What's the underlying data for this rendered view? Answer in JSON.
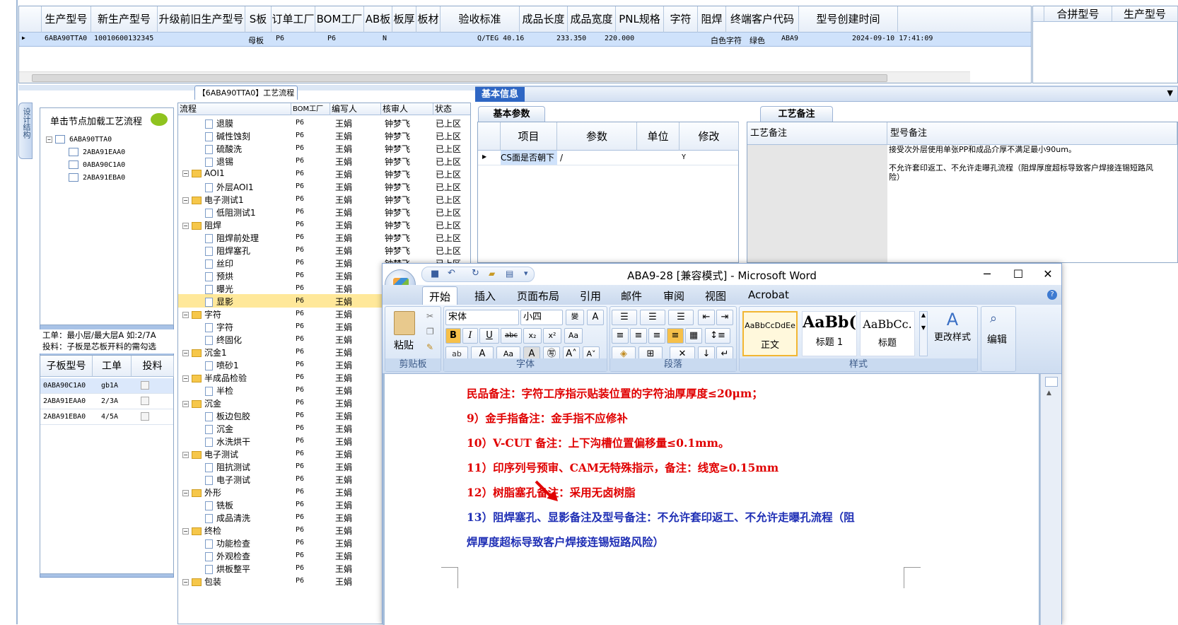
{
  "top_grid": {
    "headers": [
      "生产型号",
      "新生产型号",
      "升级前旧生产型号",
      "S板",
      "订单工厂",
      "BOM工厂",
      "AB板",
      "板厚",
      "板材",
      "验收标准",
      "成品长度",
      "成品宽度",
      "PNL规格",
      "字符",
      "阻焊",
      "终端客户代码",
      "型号创建时间"
    ],
    "row": {
      "prod_no": "6ABA90TTA0",
      "new_no": "10010600132345",
      "sboard": "母板",
      "order_factory": "P6",
      "bom_factory": "P6",
      "ab": "N",
      "standard": "Q/TEG 40.16",
      "length": "233.350",
      "width": "220.000",
      "char": "白色字符",
      "mask": "绿色",
      "customer": "ABA9",
      "created": "2024-09-10 17:41:09"
    }
  },
  "merge_grid": {
    "headers": [
      "合拼型号",
      "生产型号"
    ]
  },
  "left_panel": {
    "vtab": "设计结构",
    "tree_title": "单击节点加载工艺流程",
    "tree_root": "6ABA90TTA0",
    "tree_children": [
      "2ABA91EAA0",
      "0ABA90C1A0",
      "2ABA91EBA0"
    ],
    "info_line1": "工单：最小层/最大层A 如:2/7A",
    "info_line2": "投料：子板是芯板开料的需勾选",
    "sub_headers": [
      "子板型号",
      "工单",
      "投料"
    ],
    "sub_rows": [
      {
        "model": "0ABA90C1A0",
        "order": "gb1A"
      },
      {
        "model": "2ABA91EAA0",
        "order": "2/3A"
      },
      {
        "model": "2ABA91EBA0",
        "order": "4/5A"
      }
    ]
  },
  "process": {
    "title": "【6ABA90TTA0】工艺流程",
    "headers": [
      "流程",
      "BOM工厂",
      "编写人",
      "核审人",
      "状态"
    ],
    "rows": [
      {
        "name": "退膜",
        "folder": false,
        "bom": "P6",
        "writer": "王娟",
        "reviewer": "钟梦飞",
        "status": "已上区"
      },
      {
        "name": "碱性蚀刻",
        "folder": false,
        "bom": "P6",
        "writer": "王娟",
        "reviewer": "钟梦飞",
        "status": "已上区"
      },
      {
        "name": "硫酸洗",
        "folder": false,
        "bom": "P6",
        "writer": "王娟",
        "reviewer": "钟梦飞",
        "status": "已上区"
      },
      {
        "name": "退锡",
        "folder": false,
        "bom": "P6",
        "writer": "王娟",
        "reviewer": "钟梦飞",
        "status": "已上区"
      },
      {
        "name": "AOI1",
        "folder": true,
        "bom": "P6",
        "writer": "王娟",
        "reviewer": "钟梦飞",
        "status": "已上区"
      },
      {
        "name": "外层AOI1",
        "folder": false,
        "bom": "P6",
        "writer": "王娟",
        "reviewer": "钟梦飞",
        "status": "已上区"
      },
      {
        "name": "电子测试1",
        "folder": true,
        "bom": "P6",
        "writer": "王娟",
        "reviewer": "钟梦飞",
        "status": "已上区"
      },
      {
        "name": "低阻测试1",
        "folder": false,
        "bom": "P6",
        "writer": "王娟",
        "reviewer": "钟梦飞",
        "status": "已上区"
      },
      {
        "name": "阻焊",
        "folder": true,
        "bom": "P6",
        "writer": "王娟",
        "reviewer": "钟梦飞",
        "status": "已上区"
      },
      {
        "name": "阻焊前处理",
        "folder": false,
        "bom": "P6",
        "writer": "王娟",
        "reviewer": "钟梦飞",
        "status": "已上区"
      },
      {
        "name": "阻焊塞孔",
        "folder": false,
        "bom": "P6",
        "writer": "王娟",
        "reviewer": "钟梦飞",
        "status": "已上区"
      },
      {
        "name": "丝印",
        "folder": false,
        "bom": "P6",
        "writer": "王娟",
        "reviewer": "钟梦飞",
        "status": "已上区"
      },
      {
        "name": "预烘",
        "folder": false,
        "bom": "P6",
        "writer": "王娟",
        "reviewer": "",
        "status": ""
      },
      {
        "name": "曝光",
        "folder": false,
        "bom": "P6",
        "writer": "王娟",
        "reviewer": "",
        "status": ""
      },
      {
        "name": "显影",
        "folder": false,
        "bom": "P6",
        "writer": "王娟",
        "reviewer": "",
        "status": ""
      },
      {
        "name": "字符",
        "folder": true,
        "bom": "P6",
        "writer": "王娟",
        "reviewer": "",
        "status": ""
      },
      {
        "name": "字符",
        "folder": false,
        "bom": "P6",
        "writer": "王娟",
        "reviewer": "",
        "status": ""
      },
      {
        "name": "终固化",
        "folder": false,
        "bom": "P6",
        "writer": "王娟",
        "reviewer": "",
        "status": ""
      },
      {
        "name": "沉金1",
        "folder": true,
        "bom": "P6",
        "writer": "王娟",
        "reviewer": "",
        "status": ""
      },
      {
        "name": "喷砂1",
        "folder": false,
        "bom": "P6",
        "writer": "王娟",
        "reviewer": "",
        "status": ""
      },
      {
        "name": "半成品检验",
        "folder": true,
        "bom": "P6",
        "writer": "王娟",
        "reviewer": "",
        "status": ""
      },
      {
        "name": "半检",
        "folder": false,
        "bom": "P6",
        "writer": "王娟",
        "reviewer": "",
        "status": ""
      },
      {
        "name": "沉金",
        "folder": true,
        "bom": "P6",
        "writer": "王娟",
        "reviewer": "",
        "status": ""
      },
      {
        "name": "板边包胶",
        "folder": false,
        "bom": "P6",
        "writer": "王娟",
        "reviewer": "",
        "status": ""
      },
      {
        "name": "沉金",
        "folder": false,
        "bom": "P6",
        "writer": "王娟",
        "reviewer": "",
        "status": ""
      },
      {
        "name": "水洗烘干",
        "folder": false,
        "bom": "P6",
        "writer": "王娟",
        "reviewer": "",
        "status": ""
      },
      {
        "name": "电子测试",
        "folder": true,
        "bom": "P6",
        "writer": "王娟",
        "reviewer": "",
        "status": ""
      },
      {
        "name": "阻抗测试",
        "folder": false,
        "bom": "P6",
        "writer": "王娟",
        "reviewer": "",
        "status": ""
      },
      {
        "name": "电子测试",
        "folder": false,
        "bom": "P6",
        "writer": "王娟",
        "reviewer": "",
        "status": ""
      },
      {
        "name": "外形",
        "folder": true,
        "bom": "P6",
        "writer": "王娟",
        "reviewer": "",
        "status": ""
      },
      {
        "name": "铣板",
        "folder": false,
        "bom": "P6",
        "writer": "王娟",
        "reviewer": "",
        "status": ""
      },
      {
        "name": "成品清洗",
        "folder": false,
        "bom": "P6",
        "writer": "王娟",
        "reviewer": "",
        "status": ""
      },
      {
        "name": "终检",
        "folder": true,
        "bom": "P6",
        "writer": "王娟",
        "reviewer": "",
        "status": ""
      },
      {
        "name": "功能检查",
        "folder": false,
        "bom": "P6",
        "writer": "王娟",
        "reviewer": "",
        "status": ""
      },
      {
        "name": "外观检查",
        "folder": false,
        "bom": "P6",
        "writer": "王娟",
        "reviewer": "",
        "status": ""
      },
      {
        "name": "烘板整平",
        "folder": false,
        "bom": "P6",
        "writer": "王娟",
        "reviewer": "",
        "status": ""
      },
      {
        "name": "包装",
        "folder": true,
        "bom": "P6",
        "writer": "王娟",
        "reviewer": "",
        "status": ""
      }
    ],
    "selected_index": 14
  },
  "basic_info": {
    "tab": "基本信息",
    "param_tab": "基本参数",
    "param_headers": [
      "项目",
      "参数",
      "单位",
      "修改"
    ],
    "param_row": {
      "item": "CS面是否朝下",
      "value": "/",
      "unit": "",
      "edit": "Y"
    },
    "craft_tab": "工艺备注",
    "craft_headers": [
      "工艺备注",
      "型号备注"
    ],
    "model_note": "接受次外层使用单张PP和成品介厚不满足最小90um。\n\n不允许套印返工、不允许走曝孔流程（阻焊厚度超标导致客户焊接连锡短路风险）"
  },
  "word": {
    "title": "ABA9-28 [兼容模式] - Microsoft Word",
    "tabs": [
      "开始",
      "插入",
      "页面布局",
      "引用",
      "邮件",
      "审阅",
      "视图",
      "Acrobat"
    ],
    "font_name": "宋体",
    "font_size": "小四",
    "groups": [
      "剪贴板",
      "字体",
      "段落",
      "样式"
    ],
    "paste_label": "粘贴",
    "styles": [
      {
        "sample": "AaBbCcDdEe",
        "name": "正文"
      },
      {
        "sample": "AaBb(",
        "name": "标题 1"
      },
      {
        "sample": "AaBbCc.",
        "name": "标题"
      }
    ],
    "change_styles": "更改样式",
    "edit": "编辑",
    "lines": [
      {
        "text": "民品备注：字符工序指示贴装位置的字符油厚厚度≤20μm；",
        "color": "red"
      },
      {
        "text": "9）金手指备注：金手指不应修补",
        "color": "red"
      },
      {
        "text": "10）V-CUT 备注：上下沟槽位置偏移量≤0.1mm。",
        "color": "red"
      },
      {
        "text": "11）印序列号预审、CAM无特殊指示，备注：线宽≥0.15mm",
        "color": "red"
      },
      {
        "text": "12）树脂塞孔备注：采用无卤树脂",
        "color": "red"
      },
      {
        "text": "13）阻焊塞孔、显影备注及型号备注：不允许套印返工、不允许走曝孔流程（阻",
        "color": "blue"
      },
      {
        "text": "焊厚度超标导致客户焊接连锡短路风险）",
        "color": "blue"
      }
    ]
  }
}
